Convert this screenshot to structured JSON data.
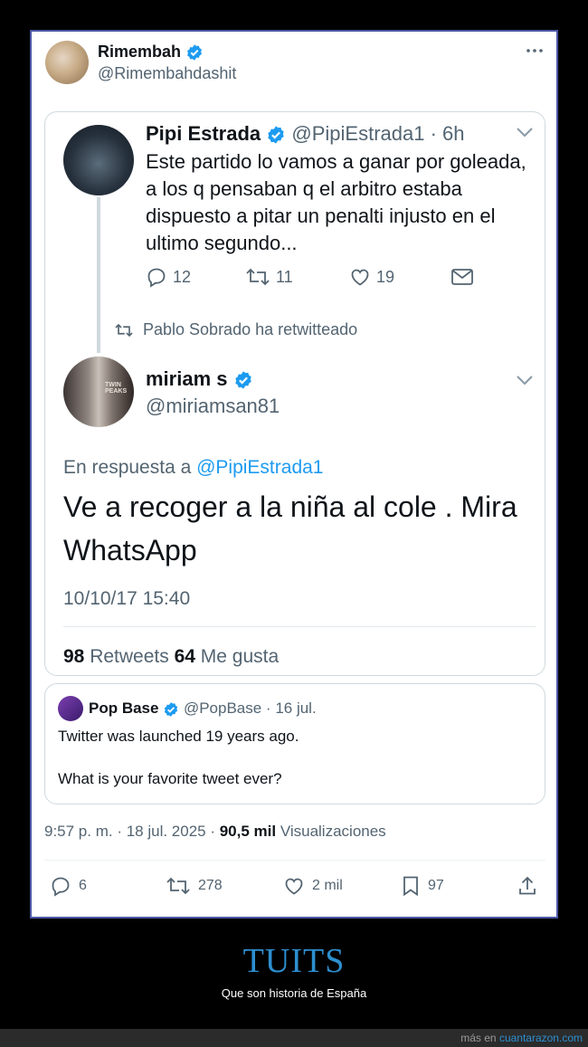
{
  "tweet": {
    "author_name": "Rimembah",
    "author_handle": "@Rimembahdashit",
    "meta_time": "9:57 p. m. · 18 jul. 2025 · ",
    "views_count": "90,5 mil",
    "views_label": " Visualizaciones",
    "actions": {
      "replies": "6",
      "retweets": "278",
      "likes": "2 mil",
      "bookmarks": "97"
    }
  },
  "screenshot": {
    "tweet1": {
      "name": "Pipi Estrada",
      "handle_time": " @PipiEstrada1 · 6h",
      "text": "Este partido lo vamos a ganar por goleada, a los q pensaban q el arbitro estaba dispuesto a pitar un penalti injusto en el ultimo segundo...",
      "replies": "12",
      "retweets": "11",
      "likes": "19"
    },
    "retweeted_by": "Pablo Sobrado ha retwitteado",
    "tweet2": {
      "name": "miriam s",
      "handle": "@miriamsan81",
      "avatar_text": "TWIN PEAKS",
      "reply_prefix": "En respuesta a ",
      "reply_mention": "@PipiEstrada1",
      "text": "Ve a recoger a la niña al cole . Mira WhatsApp",
      "time": "10/10/17 15:40",
      "retweets_count": "98",
      "retweets_label": " Retweets ",
      "likes_count": "64",
      "likes_label": " Me gusta"
    }
  },
  "quote": {
    "name": "Pop Base",
    "handle_date": " @PopBase · 16 jul.",
    "line1": "Twitter was launched 19 years ago.",
    "line2": "What is your favorite tweet ever?"
  },
  "caption": {
    "title": "TUITS",
    "subtitle": "Que son historia de España"
  },
  "footer": {
    "prefix": "más en ",
    "site": "cuantarazon.com"
  },
  "colors": {
    "verified": "#1d9bf0",
    "caption_title": "#2d8fd0",
    "frame_border": "#4b57a6"
  }
}
